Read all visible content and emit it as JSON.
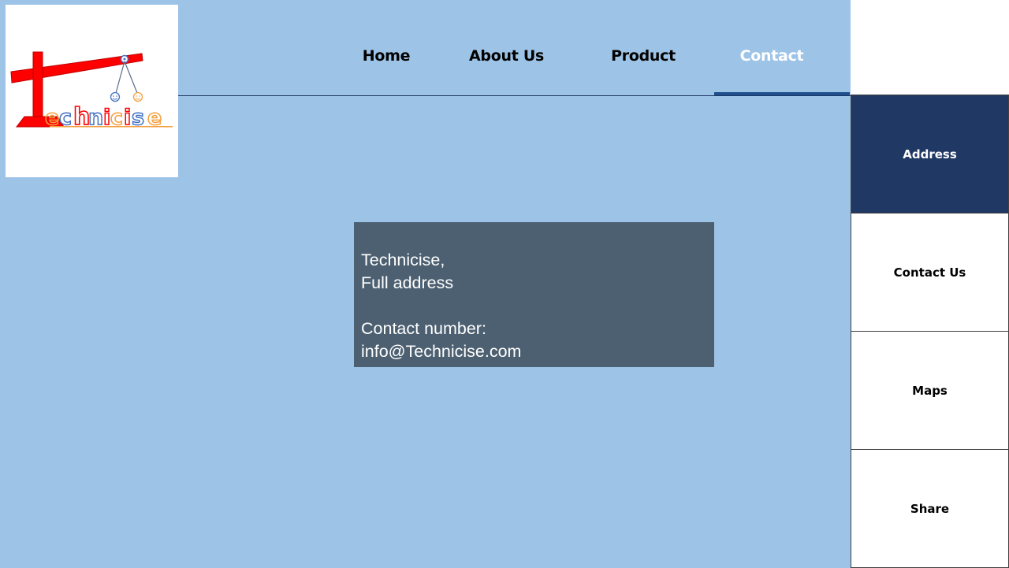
{
  "logo": {
    "text": "Technicise"
  },
  "nav": {
    "items": [
      {
        "label": "Home"
      },
      {
        "label": "About Us"
      },
      {
        "label": "Product"
      },
      {
        "label": "Contact"
      }
    ],
    "active": "Contact"
  },
  "contact_box": {
    "line1": "Technicise,",
    "line2": "Full address",
    "line3": "Contact number:",
    "line4": "info@Technicise.com"
  },
  "sidebar": {
    "items": [
      {
        "label": "Address"
      },
      {
        "label": "Contact Us"
      },
      {
        "label": "Maps"
      },
      {
        "label": "Share"
      }
    ],
    "active": "Address"
  },
  "colors": {
    "background": "#9dc3e6",
    "active_sidebar": "#203864",
    "info_box": "#4d6071",
    "nav_underline": "#1f4e8c"
  }
}
